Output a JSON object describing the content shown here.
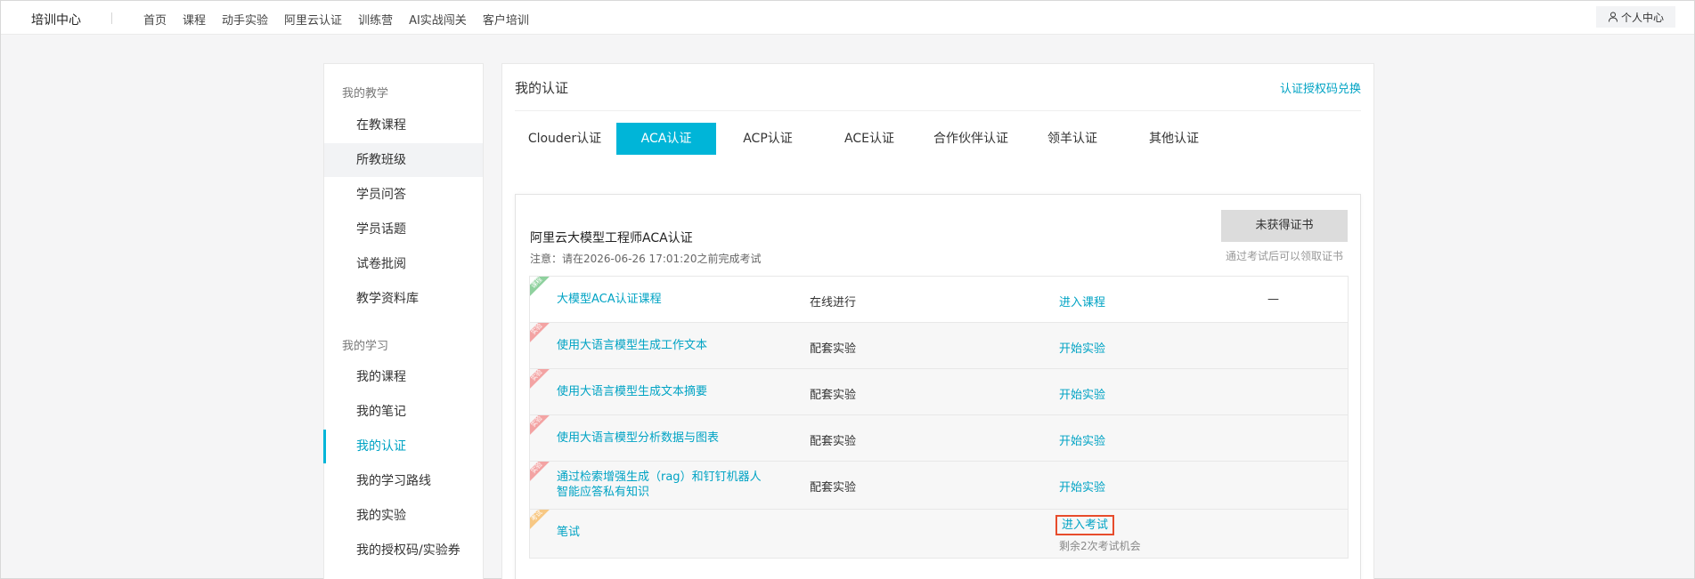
{
  "topnav": {
    "brand": "培训中心",
    "links": [
      "首页",
      "课程",
      "动手实验",
      "阿里云认证",
      "训练营",
      "AI实战闯关",
      "客户培训"
    ],
    "user_center": "个人中心"
  },
  "sidebar": {
    "group_teaching": "我的教学",
    "teaching_items": [
      "在教课程",
      "所教班级",
      "学员问答",
      "学员话题",
      "试卷批阅",
      "教学资料库"
    ],
    "group_learning": "我的学习",
    "learning_items": [
      "我的课程",
      "我的笔记",
      "我的认证",
      "我的学习路线",
      "我的实验",
      "我的授权码/实验券"
    ]
  },
  "main": {
    "title": "我的认证",
    "redeem": "认证授权码兑换",
    "tabs": [
      "Clouder认证",
      "ACA认证",
      "ACP认证",
      "ACE认证",
      "合作伙伴认证",
      "领羊认证",
      "其他认证"
    ],
    "active_tab": "ACA认证"
  },
  "cert": {
    "name": "阿里云大模型工程师ACA认证",
    "note": "注意：请在2026-06-26 17:01:20之前完成考试",
    "button": "未获得证书",
    "hint": "通过考试后可以领取证书",
    "rows": [
      {
        "tag": "课程",
        "name": "大模型ACA认证课程",
        "type": "在线进行",
        "action": "进入课程",
        "extra": "—"
      },
      {
        "tag": "实验",
        "name": "使用大语言模型生成工作文本",
        "type": "配套实验",
        "action": "开始实验"
      },
      {
        "tag": "实验",
        "name": "使用大语言模型生成文本摘要",
        "type": "配套实验",
        "action": "开始实验"
      },
      {
        "tag": "实验",
        "name": "使用大语言模型分析数据与图表",
        "type": "配套实验",
        "action": "开始实验"
      },
      {
        "tag": "实验",
        "name": "通过检索增强生成（rag）和钉钉机器人智能应答私有知识",
        "type": "配套实验",
        "action": "开始实验"
      },
      {
        "tag": "考试",
        "name": "笔试",
        "action": "进入考试",
        "remaining": "剩余2次考试机会"
      }
    ]
  },
  "colors": {
    "accent": "#00b5d8",
    "link": "#00a3c4",
    "highlight_border": "#e74c2c"
  }
}
